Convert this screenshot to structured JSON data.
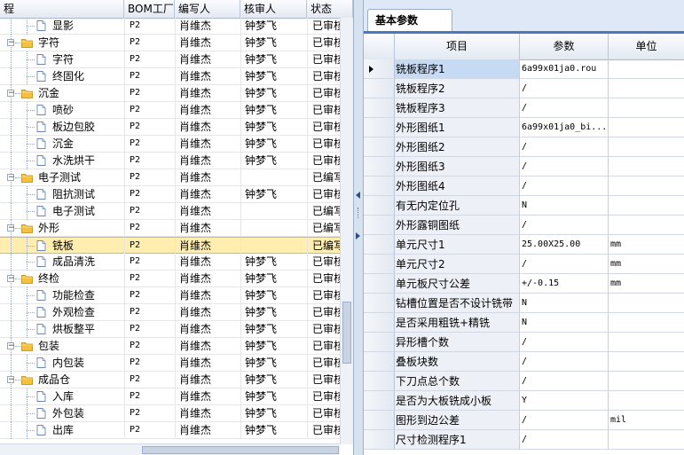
{
  "left": {
    "columns": [
      "程",
      "BOM工厂",
      "编写人",
      "核审人",
      "状态"
    ],
    "rows": [
      {
        "level": 1,
        "type": "file",
        "label": "显影",
        "bom": "P2",
        "writer": "肖维杰",
        "reviewer": "钟梦飞",
        "status": "已审核"
      },
      {
        "level": 0,
        "type": "folder",
        "label": "字符",
        "bom": "P2",
        "writer": "肖维杰",
        "reviewer": "钟梦飞",
        "status": "已审核"
      },
      {
        "level": 1,
        "type": "file",
        "label": "字符",
        "bom": "P2",
        "writer": "肖维杰",
        "reviewer": "钟梦飞",
        "status": "已审核"
      },
      {
        "level": 1,
        "type": "file",
        "label": "终固化",
        "bom": "P2",
        "writer": "肖维杰",
        "reviewer": "钟梦飞",
        "status": "已审核"
      },
      {
        "level": 0,
        "type": "folder",
        "label": "沉金",
        "bom": "P2",
        "writer": "肖维杰",
        "reviewer": "钟梦飞",
        "status": "已审核"
      },
      {
        "level": 1,
        "type": "file",
        "label": "喷砂",
        "bom": "P2",
        "writer": "肖维杰",
        "reviewer": "钟梦飞",
        "status": "已审核"
      },
      {
        "level": 1,
        "type": "file",
        "label": "板边包胶",
        "bom": "P2",
        "writer": "肖维杰",
        "reviewer": "钟梦飞",
        "status": "已审核"
      },
      {
        "level": 1,
        "type": "file",
        "label": "沉金",
        "bom": "P2",
        "writer": "肖维杰",
        "reviewer": "钟梦飞",
        "status": "已审核"
      },
      {
        "level": 1,
        "type": "file",
        "label": "水洗烘干",
        "bom": "P2",
        "writer": "肖维杰",
        "reviewer": "钟梦飞",
        "status": "已审核"
      },
      {
        "level": 0,
        "type": "folder",
        "label": "电子测试",
        "bom": "P2",
        "writer": "肖维杰",
        "reviewer": "",
        "status": "已编写"
      },
      {
        "level": 1,
        "type": "file",
        "label": "阻抗测试",
        "bom": "P2",
        "writer": "肖维杰",
        "reviewer": "钟梦飞",
        "status": "已审核"
      },
      {
        "level": 1,
        "type": "file",
        "label": "电子测试",
        "bom": "P2",
        "writer": "肖维杰",
        "reviewer": "",
        "status": "已编写"
      },
      {
        "level": 0,
        "type": "folder",
        "label": "外形",
        "bom": "P2",
        "writer": "肖维杰",
        "reviewer": "",
        "status": "已编写"
      },
      {
        "level": 1,
        "type": "file",
        "label": "铣板",
        "bom": "P2",
        "writer": "肖维杰",
        "reviewer": "",
        "status": "已编写",
        "selected": true
      },
      {
        "level": 1,
        "type": "file",
        "label": "成品清洗",
        "bom": "P2",
        "writer": "肖维杰",
        "reviewer": "钟梦飞",
        "status": "已审核"
      },
      {
        "level": 0,
        "type": "folder",
        "label": "终检",
        "bom": "P2",
        "writer": "肖维杰",
        "reviewer": "钟梦飞",
        "status": "已审核"
      },
      {
        "level": 1,
        "type": "file",
        "label": "功能检查",
        "bom": "P2",
        "writer": "肖维杰",
        "reviewer": "钟梦飞",
        "status": "已审核"
      },
      {
        "level": 1,
        "type": "file",
        "label": "外观检查",
        "bom": "P2",
        "writer": "肖维杰",
        "reviewer": "钟梦飞",
        "status": "已审核"
      },
      {
        "level": 1,
        "type": "file",
        "label": "烘板整平",
        "bom": "P2",
        "writer": "肖维杰",
        "reviewer": "钟梦飞",
        "status": "已审核"
      },
      {
        "level": 0,
        "type": "folder",
        "label": "包装",
        "bom": "P2",
        "writer": "肖维杰",
        "reviewer": "钟梦飞",
        "status": "已审核"
      },
      {
        "level": 1,
        "type": "file",
        "label": "内包装",
        "bom": "P2",
        "writer": "肖维杰",
        "reviewer": "钟梦飞",
        "status": "已审核"
      },
      {
        "level": 0,
        "type": "folder",
        "label": "成品仓",
        "bom": "P2",
        "writer": "肖维杰",
        "reviewer": "钟梦飞",
        "status": "已审核"
      },
      {
        "level": 1,
        "type": "file",
        "label": "入库",
        "bom": "P2",
        "writer": "肖维杰",
        "reviewer": "钟梦飞",
        "status": "已审核"
      },
      {
        "level": 1,
        "type": "file",
        "label": "外包装",
        "bom": "P2",
        "writer": "肖维杰",
        "reviewer": "钟梦飞",
        "status": "已审核"
      },
      {
        "level": 1,
        "type": "file",
        "label": "出库",
        "bom": "P2",
        "writer": "肖维杰",
        "reviewer": "钟梦飞",
        "status": "已审核"
      }
    ]
  },
  "right": {
    "tab_label": "基本参数",
    "columns": [
      "项目",
      "参数",
      "单位"
    ],
    "rows": [
      {
        "name": "铣板程序1",
        "value": "6a99x01ja0.rou",
        "unit": "",
        "selected": true
      },
      {
        "name": "铣板程序2",
        "value": "/",
        "unit": ""
      },
      {
        "name": "铣板程序3",
        "value": "/",
        "unit": ""
      },
      {
        "name": "外形图纸1",
        "value": "6a99x01ja0_bi...",
        "unit": ""
      },
      {
        "name": "外形图纸2",
        "value": "/",
        "unit": ""
      },
      {
        "name": "外形图纸3",
        "value": "/",
        "unit": ""
      },
      {
        "name": "外形图纸4",
        "value": "/",
        "unit": ""
      },
      {
        "name": "有无内定位孔",
        "value": "N",
        "unit": ""
      },
      {
        "name": "外形露铜图纸",
        "value": "/",
        "unit": ""
      },
      {
        "name": "单元尺寸1",
        "value": "25.00X25.00",
        "unit": "mm"
      },
      {
        "name": "单元尺寸2",
        "value": "/",
        "unit": "mm"
      },
      {
        "name": "单元板尺寸公差",
        "value": "+/-0.15",
        "unit": "mm"
      },
      {
        "name": "钻槽位置是否不设计铣带",
        "value": "N",
        "unit": ""
      },
      {
        "name": "是否采用粗铣+精铣",
        "value": "N",
        "unit": ""
      },
      {
        "name": "异形槽个数",
        "value": "/",
        "unit": ""
      },
      {
        "name": "叠板块数",
        "value": "/",
        "unit": ""
      },
      {
        "name": "下刀点总个数",
        "value": "/",
        "unit": ""
      },
      {
        "name": "是否为大板铣成小板",
        "value": "Y",
        "unit": ""
      },
      {
        "name": "图形到边公差",
        "value": "/",
        "unit": "mil"
      },
      {
        "name": "尺寸检测程序1",
        "value": "/",
        "unit": ""
      }
    ]
  },
  "colors": {
    "selection_left": "#ffeeb0",
    "selection_right": "#c7daf3",
    "accent": "#4a78c0",
    "folder": "#f3c13a"
  }
}
